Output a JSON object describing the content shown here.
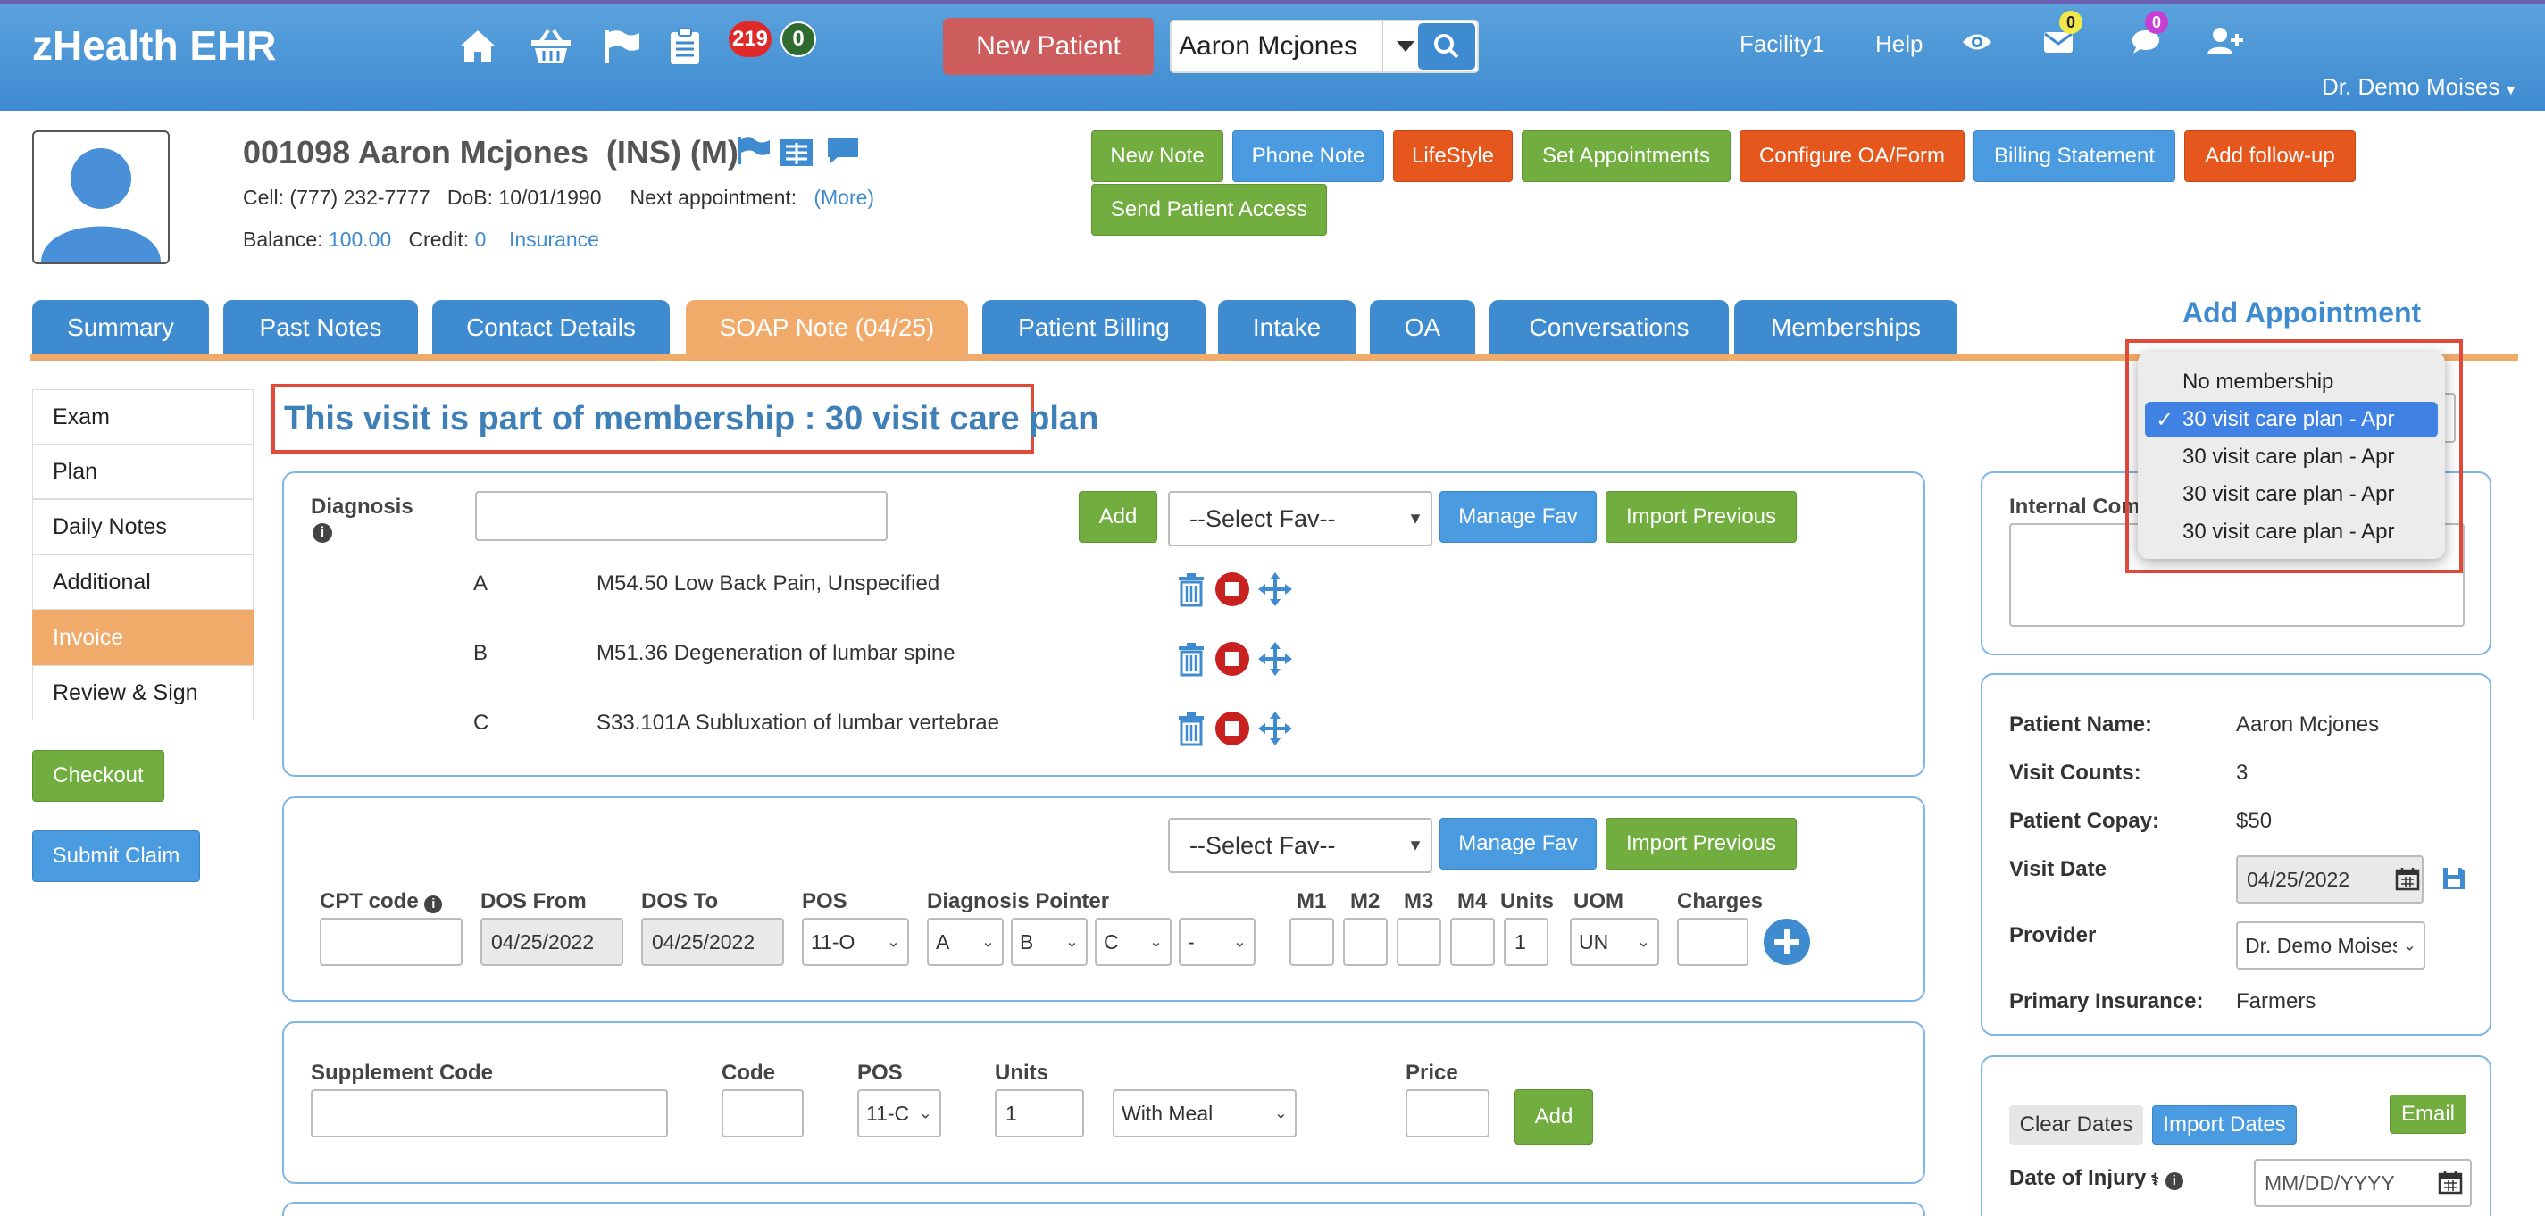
{
  "app": {
    "brand": "zHealth EHR"
  },
  "topbar": {
    "badge_red": "219",
    "badge_green": "0",
    "new_patient_label": "New Patient",
    "search_value": "Aaron Mcjones",
    "facility": "Facility1",
    "help": "Help",
    "mail_badge": "0",
    "chat_badge": "0",
    "doctor": "Dr. Demo Moises"
  },
  "patient": {
    "id_name": "001098 Aaron Mcjones",
    "tag": "(INS) (M)",
    "cell_label": "Cell:",
    "cell": "(777) 232-7777",
    "dob_label": "DoB:",
    "dob": "10/01/1990",
    "next_appt_label": "Next appointment:",
    "more": "(More)",
    "balance_label": "Balance:",
    "balance": "100.00",
    "credit_label": "Credit:",
    "credit": "0",
    "insurance": "Insurance"
  },
  "actions": {
    "new_note": "New Note",
    "phone_note": "Phone Note",
    "lifestyle": "LifeStyle",
    "set_appointments": "Set Appointments",
    "configure_oa": "Configure OA/Form",
    "billing_statement": "Billing Statement",
    "add_followup": "Add follow-up",
    "send_access": "Send Patient Access"
  },
  "tabs": [
    {
      "label": "Summary"
    },
    {
      "label": "Past Notes"
    },
    {
      "label": "Contact Details"
    },
    {
      "label": "SOAP Note (04/25)"
    },
    {
      "label": "Patient Billing"
    },
    {
      "label": "Intake"
    },
    {
      "label": "OA"
    },
    {
      "label": "Conversations"
    },
    {
      "label": "Memberships"
    }
  ],
  "add_appointment": "Add Appointment",
  "leftnav": [
    {
      "label": "Exam"
    },
    {
      "label": "Plan"
    },
    {
      "label": "Daily Notes"
    },
    {
      "label": "Additional"
    },
    {
      "label": "Invoice"
    },
    {
      "label": "Review & Sign"
    }
  ],
  "checkout": "Checkout",
  "submit_claim": "Submit Claim",
  "membership_banner": "This visit is part of membership : 30 visit care plan",
  "diagnosis": {
    "label": "Diagnosis",
    "add": "Add",
    "select_fav": "--Select Fav--",
    "manage_fav": "Manage Fav",
    "import_previous": "Import Previous",
    "rows": [
      {
        "letter": "A",
        "text": "M54.50  Low Back Pain, Unspecified"
      },
      {
        "letter": "B",
        "text": "M51.36  Degeneration of lumbar spine"
      },
      {
        "letter": "C",
        "text": "S33.101A  Subluxation of lumbar vertebrae"
      }
    ]
  },
  "cpt": {
    "select_fav": "--Select Fav--",
    "manage_fav": "Manage Fav",
    "import_previous": "Import Previous",
    "cpt_label": "CPT code",
    "dos_from_label": "DOS From",
    "dos_to_label": "DOS To",
    "pos_label": "POS",
    "dx_pointer_label": "Diagnosis Pointer",
    "m1": "M1",
    "m2": "M2",
    "m3": "M3",
    "m4": "M4",
    "units_label": "Units",
    "uom_label": "UOM",
    "charges_label": "Charges",
    "dos_from": "04/25/2022",
    "dos_to": "04/25/2022",
    "pos": "11-O",
    "ptr1": "A",
    "ptr2": "B",
    "ptr3": "C",
    "ptr4": "-",
    "units": "1",
    "uom": "UN"
  },
  "supplement": {
    "label": "Supplement Code",
    "code_label": "Code",
    "pos_label": "POS",
    "units_label": "Units",
    "price_label": "Price",
    "pos": "11-C",
    "units": "1",
    "meal": "With Meal",
    "add": "Add"
  },
  "internal": {
    "label": "Internal Com"
  },
  "summary_panel": {
    "patient_name_label": "Patient Name:",
    "patient_name": "Aaron Mcjones",
    "visit_counts_label": "Visit Counts:",
    "visit_counts": "3",
    "copay_label": "Patient Copay:",
    "copay": "$50",
    "visit_date_label": "Visit Date",
    "visit_date": "04/25/2022",
    "provider_label": "Provider",
    "provider": "Dr. Demo Moises",
    "insurance_label": "Primary Insurance:",
    "insurance": "Farmers"
  },
  "dates_panel": {
    "clear_dates": "Clear Dates",
    "import_dates": "Import Dates",
    "email": "Email",
    "injury_label": "Date of Injury",
    "injury_placeholder": "MM/DD/YYYY"
  },
  "membership_dropdown": {
    "options": [
      {
        "label": "No membership"
      },
      {
        "label": "30 visit care plan - Apr"
      },
      {
        "label": "30 visit care plan - Apr"
      },
      {
        "label": "30 visit care plan - Apr"
      },
      {
        "label": "30 visit care plan - Apr"
      }
    ],
    "check": "✓"
  }
}
